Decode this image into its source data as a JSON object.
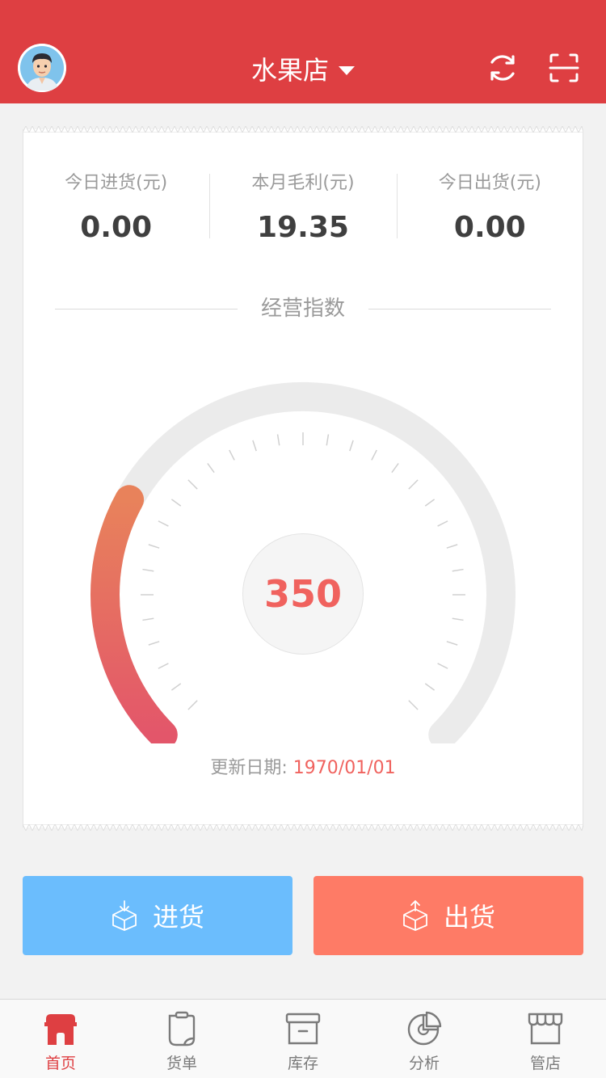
{
  "header": {
    "store_name": "水果店",
    "icons": [
      "avatar",
      "refresh-icon",
      "scan-icon"
    ],
    "color": "#de3f42"
  },
  "stats": [
    {
      "label": "今日进货(元)",
      "value": "0.00"
    },
    {
      "label": "本月毛利(元)",
      "value": "19.35"
    },
    {
      "label": "今日出货(元)",
      "value": "0.00"
    }
  ],
  "index_section": {
    "title": "经营指数",
    "score": "350",
    "gauge_max_hint": 1000,
    "update_label": "更新日期:",
    "update_date": "1970/01/01",
    "accent": "#f0625e"
  },
  "actions": {
    "stock_in": {
      "label": "进货",
      "color": "#6bbdfd",
      "icon": "box-in-icon"
    },
    "stock_out": {
      "label": "出货",
      "color": "#fe7b66",
      "icon": "box-out-icon"
    }
  },
  "tabbar": {
    "items": [
      {
        "label": "首页",
        "icon": "home-icon",
        "active": true
      },
      {
        "label": "货单",
        "icon": "document-icon",
        "active": false
      },
      {
        "label": "库存",
        "icon": "archive-icon",
        "active": false
      },
      {
        "label": "分析",
        "icon": "pie-chart-icon",
        "active": false
      },
      {
        "label": "管店",
        "icon": "store-icon",
        "active": false
      }
    ]
  }
}
